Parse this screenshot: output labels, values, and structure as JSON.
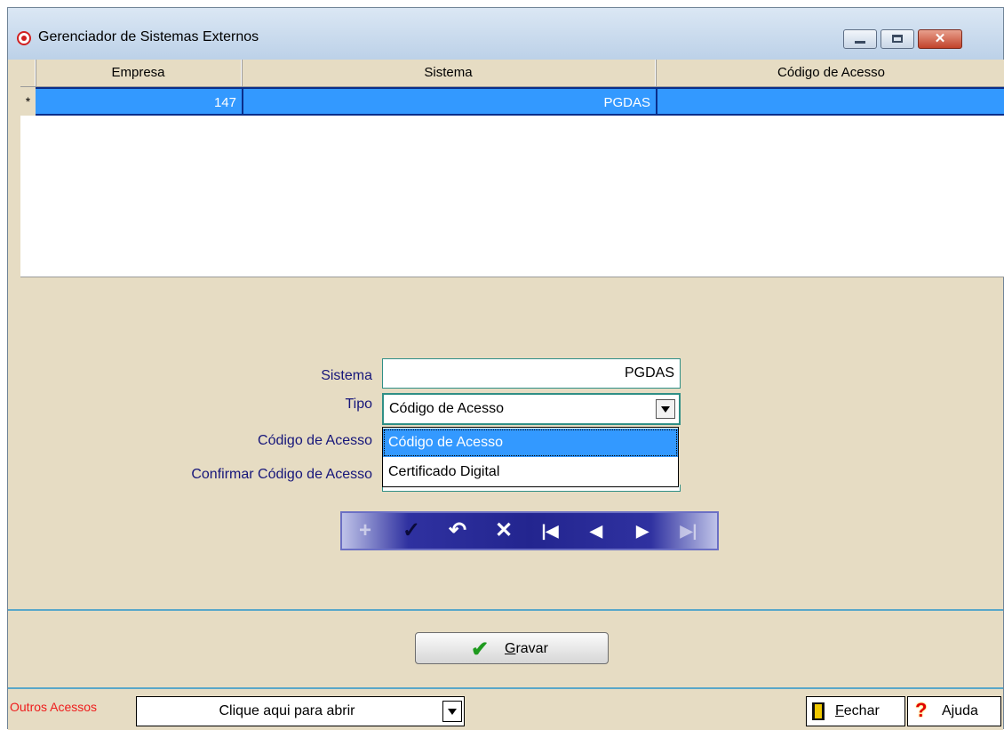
{
  "window": {
    "title": "Gerenciador de Sistemas Externos",
    "icon": "target-app-icon",
    "controls": [
      "minimize-icon",
      "maximize-icon",
      "close-icon"
    ],
    "close_glyph": "✕"
  },
  "grid": {
    "columns": [
      "Empresa",
      "Sistema",
      "Código de Acesso"
    ],
    "rows": [
      {
        "indicator": "*",
        "empresa": "147",
        "sistema": "PGDAS",
        "codigo": ""
      }
    ]
  },
  "form": {
    "sistema_label": "Sistema",
    "sistema_value": "PGDAS",
    "tipo_label": "Tipo",
    "tipo_value": "Código de Acesso",
    "tipo_options": [
      "Código de Acesso",
      "Certificado Digital"
    ],
    "codigo_label": "Código de Acesso",
    "confirmar_label": "Confirmar Código de Acesso"
  },
  "navigator": {
    "buttons": [
      {
        "name": "add-record",
        "glyph": "+"
      },
      {
        "name": "confirm-record",
        "glyph": "✓"
      },
      {
        "name": "undo-record",
        "glyph": "↶"
      },
      {
        "name": "delete-record",
        "glyph": "✕"
      },
      {
        "name": "first-record",
        "glyph": "|◀"
      },
      {
        "name": "previous-record",
        "glyph": "◀"
      },
      {
        "name": "next-record",
        "glyph": "▶"
      },
      {
        "name": "last-record",
        "glyph": "▶|"
      }
    ]
  },
  "actions": {
    "gravar_hotkey": "G",
    "gravar_rest": "ravar"
  },
  "bottom": {
    "outros_label": "Outros Acessos",
    "outros_value": "Clique aqui para abrir",
    "fechar_hotkey": "F",
    "fechar_rest": "echar",
    "ajuda_label": "Ajuda"
  },
  "colors": {
    "selection": "#3399ff",
    "panel": "#e6dcc3",
    "label_text": "#16167a",
    "outros_label": "#ee1c1c"
  }
}
